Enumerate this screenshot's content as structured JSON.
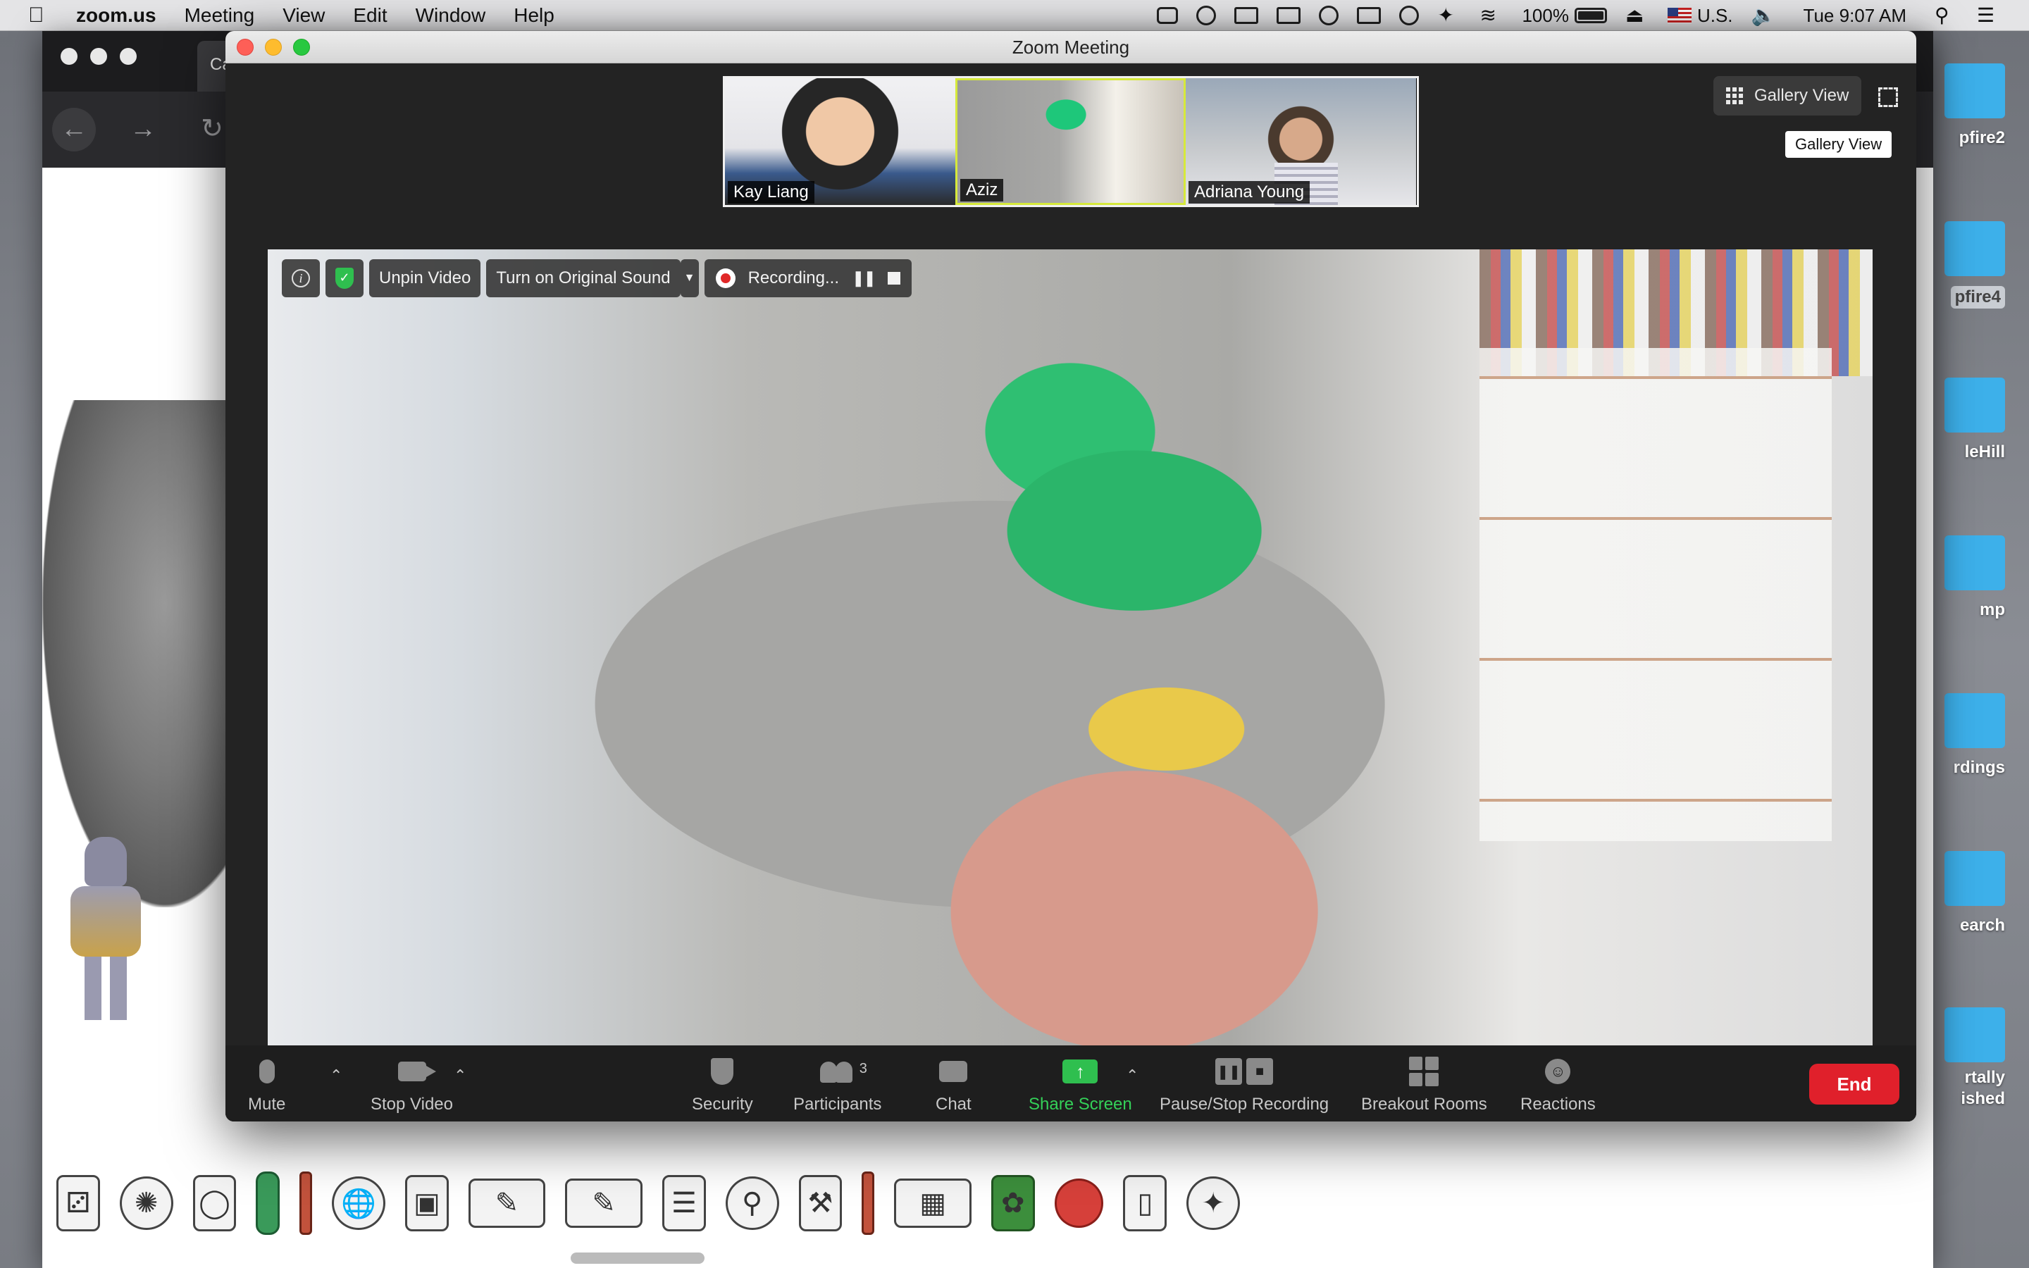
{
  "menubar": {
    "apple_icon": "apple-icon",
    "app_name": "zoom.us",
    "items": [
      "Meeting",
      "View",
      "Edit",
      "Window",
      "Help"
    ],
    "battery": "100%",
    "input_source": "U.S.",
    "clock": "Tue 9:07 AM"
  },
  "browser": {
    "tab_label": "Ca"
  },
  "desktop_icons": [
    "pfire2",
    "pfire4",
    "leHill",
    "mp",
    "rdings",
    "earch",
    "rtally",
    "ished"
  ],
  "zoom": {
    "window_title": "Zoom Meeting",
    "participants_thumbs": [
      {
        "name": "Kay Liang"
      },
      {
        "name": "Aziz"
      },
      {
        "name": "Adriana Young"
      }
    ],
    "view_button": "Gallery View",
    "view_tooltip": "Gallery View",
    "video_toolbar": {
      "unpin": "Unpin Video",
      "original_sound": "Turn on Original Sound",
      "recording": "Recording..."
    },
    "controls": {
      "mute": "Mute",
      "stop_video": "Stop Video",
      "security": "Security",
      "participants": "Participants",
      "participants_count": "3",
      "chat": "Chat",
      "share_screen": "Share Screen",
      "pause_stop_recording": "Pause/Stop Recording",
      "breakout_rooms": "Breakout Rooms",
      "reactions": "Reactions",
      "end": "End"
    }
  },
  "colors": {
    "end_button": "#e0202b",
    "share_green": "#34d058",
    "record_red": "#e02828"
  }
}
